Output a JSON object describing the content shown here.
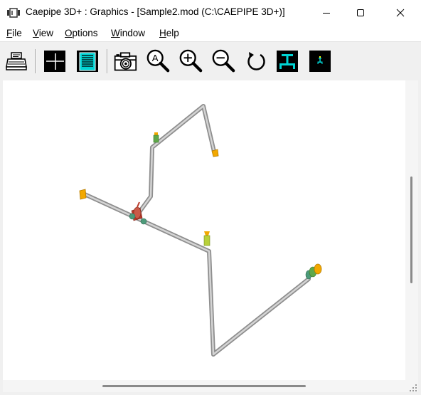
{
  "window": {
    "title": "Caepipe 3D+ : Graphics -  [Sample2.mod (C:\\CAEPIPE 3D+)]",
    "controls": {
      "minimize": "minimize-icon",
      "maximize": "maximize-icon",
      "close": "close-icon"
    }
  },
  "menu": {
    "items": [
      {
        "label": "File",
        "underline": "F",
        "rest": "ile"
      },
      {
        "label": "View",
        "underline": "V",
        "rest": "iew"
      },
      {
        "label": "Options",
        "underline": "O",
        "rest": "ptions"
      },
      {
        "label": "Window",
        "underline": "W",
        "rest": "indow"
      },
      {
        "label": "Help",
        "underline": "H",
        "rest": "elp"
      }
    ]
  },
  "toolbar": {
    "buttons": [
      {
        "name": "print-button",
        "icon": "printer-icon"
      },
      {
        "name": "crosshair-button",
        "icon": "crosshair-icon"
      },
      {
        "name": "text-view-button",
        "icon": "document-icon"
      },
      {
        "name": "camera-button",
        "icon": "camera-icon"
      },
      {
        "name": "zoom-all-button",
        "icon": "zoom-all-icon"
      },
      {
        "name": "zoom-in-button",
        "icon": "zoom-in-icon"
      },
      {
        "name": "zoom-out-button",
        "icon": "zoom-out-icon"
      },
      {
        "name": "rotate-button",
        "icon": "rotate-icon"
      },
      {
        "name": "support-large-button",
        "icon": "support-large-icon"
      },
      {
        "name": "support-small-button",
        "icon": "support-small-icon"
      }
    ]
  },
  "colors": {
    "pipe": "#a8a8a8",
    "pipe_highlight": "#d8d8d8",
    "anchor": "#f2a800",
    "hanger_green": "#5fa84a",
    "valve_red": "#b83a2a",
    "flange_green": "#4d9a7a",
    "icon_teal": "#00d4d4",
    "icon_yellow": "#ffff00"
  }
}
